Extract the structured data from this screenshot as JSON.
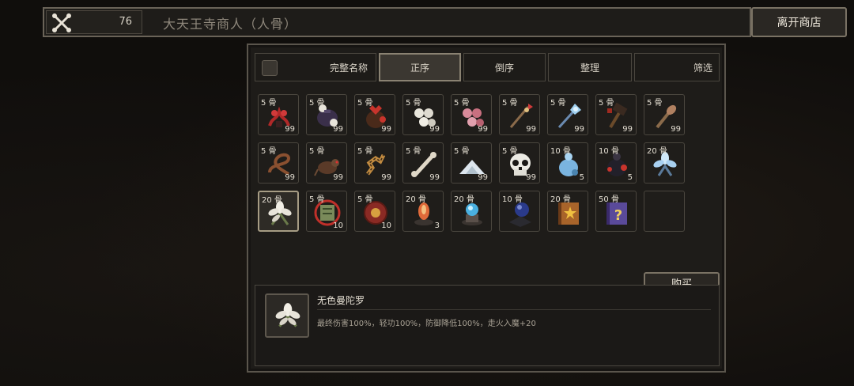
{
  "header": {
    "currency_amount": "76",
    "merchant_title": "大天王寺商人（人骨）",
    "leave_label": "离开商店"
  },
  "sort_bar": {
    "full_name_label": "完整名称",
    "tabs": [
      "正序",
      "倒序",
      "整理"
    ],
    "active_tab": "正序",
    "filter_label": "筛选"
  },
  "items": [
    {
      "price": "5 骨",
      "qty": "99",
      "icon": "red-vines-icon"
    },
    {
      "price": "5 骨",
      "qty": "99",
      "icon": "skull-pouch-icon"
    },
    {
      "price": "5 骨",
      "qty": "99",
      "icon": "heart-pouch-icon"
    },
    {
      "price": "5 骨",
      "qty": "99",
      "icon": "white-pills-icon"
    },
    {
      "price": "5 骨",
      "qty": "99",
      "icon": "pink-pills-icon"
    },
    {
      "price": "5 骨",
      "qty": "99",
      "icon": "red-spear-icon"
    },
    {
      "price": "5 骨",
      "qty": "99",
      "icon": "ice-staff-icon"
    },
    {
      "price": "5 骨",
      "qty": "99",
      "icon": "hammer-icon"
    },
    {
      "price": "5 骨",
      "qty": "99",
      "icon": "club-icon"
    },
    {
      "price": "5 骨",
      "qty": "99",
      "icon": "brown-rope-icon"
    },
    {
      "price": "5 骨",
      "qty": "99",
      "icon": "rat-icon"
    },
    {
      "price": "5 骨",
      "qty": "99",
      "icon": "chain-icon"
    },
    {
      "price": "5 骨",
      "qty": "99",
      "icon": "bone-icon"
    },
    {
      "price": "5 骨",
      "qty": "99",
      "icon": "salt-pile-icon"
    },
    {
      "price": "5 骨",
      "qty": "99",
      "icon": "skull-icon"
    },
    {
      "price": "10 骨",
      "qty": "5",
      "icon": "blue-pouch-icon"
    },
    {
      "price": "10 骨",
      "qty": "5",
      "icon": "black-pouch-icon"
    },
    {
      "price": "20 骨",
      "qty": "",
      "icon": "blue-flower-icon"
    },
    {
      "price": "20 骨",
      "qty": "",
      "icon": "white-flower-icon"
    },
    {
      "price": "5 骨",
      "qty": "10",
      "icon": "green-scroll-icon"
    },
    {
      "price": "5 骨",
      "qty": "10",
      "icon": "red-talisman-icon"
    },
    {
      "price": "20 骨",
      "qty": "3",
      "icon": "flame-crystal-icon"
    },
    {
      "price": "20 骨",
      "qty": "",
      "icon": "blue-orb-icon"
    },
    {
      "price": "10 骨",
      "qty": "",
      "icon": "dark-orb-icon"
    },
    {
      "price": "20 骨",
      "qty": "",
      "icon": "star-book-icon"
    },
    {
      "price": "50 骨",
      "qty": "",
      "icon": "mystery-book-icon"
    }
  ],
  "selected_index": 18,
  "buy_label": "购买",
  "detail": {
    "name": "无色曼陀罗",
    "description": "最终伤害100%，轻功100%，防御降低100%，走火入魔+20"
  },
  "colors": {
    "panel_bg": "#1e1c19",
    "border": "#5a554c",
    "text": "#d8d2c6",
    "selected_border": "#a69c84"
  }
}
